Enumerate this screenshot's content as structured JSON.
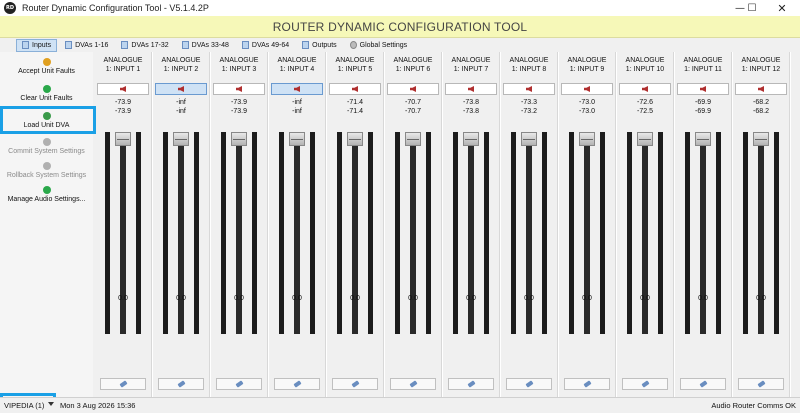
{
  "window": {
    "title": "Router Dynamic Configuration Tool - V5.1.4.2P",
    "app_icon": "RD",
    "controls": {
      "minimize": "—",
      "maximize": "☐",
      "close": "✕"
    }
  },
  "banner": {
    "title": "ROUTER DYNAMIC CONFIGURATION TOOL"
  },
  "tabs": [
    {
      "label": "Inputs",
      "active": true,
      "icon": "dva-page-icon"
    },
    {
      "label": "DVAs 1-16",
      "icon": "dva-page-icon"
    },
    {
      "label": "DVAs 17-32",
      "icon": "dva-page-icon"
    },
    {
      "label": "DVAs 33-48",
      "icon": "dva-page-icon"
    },
    {
      "label": "DVAs 49-64",
      "icon": "dva-page-icon"
    },
    {
      "label": "Outputs",
      "icon": "dva-page-icon"
    },
    {
      "label": "Global Settings",
      "icon": "gear-icon"
    }
  ],
  "sidebar": {
    "items": [
      {
        "label": "Accept Unit Faults",
        "icon": "accept-faults-icon",
        "enabled": true
      },
      {
        "label": "Clear Unit Faults",
        "icon": "check-icon",
        "enabled": true
      },
      {
        "label": "Load Unit DVA",
        "icon": "speaker-arrow-icon",
        "enabled": true
      },
      {
        "label": "Commit System Settings",
        "icon": "commit-icon",
        "enabled": false
      },
      {
        "label": "Rollback System Settings",
        "icon": "rollback-icon",
        "enabled": false
      },
      {
        "label": "Manage Audio Settings...",
        "icon": "refresh-icon",
        "enabled": true
      }
    ],
    "highlight_color": "#1aa0e6"
  },
  "channels": [
    {
      "line1": "ANALOGUE",
      "line2": "1: INPUT 1",
      "level_a": "-73.9",
      "level_b": "-73.9",
      "fader": "0.0",
      "selected": false
    },
    {
      "line1": "ANALOGUE",
      "line2": "1: INPUT 2",
      "level_a": "-inf",
      "level_b": "-inf",
      "fader": "0.0",
      "selected": true
    },
    {
      "line1": "ANALOGUE",
      "line2": "1: INPUT 3",
      "level_a": "-73.9",
      "level_b": "-73.9",
      "fader": "0.0",
      "selected": false
    },
    {
      "line1": "ANALOGUE",
      "line2": "1: INPUT 4",
      "level_a": "-inf",
      "level_b": "-inf",
      "fader": "0.0",
      "selected": true
    },
    {
      "line1": "ANALOGUE",
      "line2": "1: INPUT 5",
      "level_a": "-71.4",
      "level_b": "-71.4",
      "fader": "0.0",
      "selected": false
    },
    {
      "line1": "ANALOGUE",
      "line2": "1: INPUT 6",
      "level_a": "-70.7",
      "level_b": "-70.7",
      "fader": "0.0",
      "selected": false
    },
    {
      "line1": "ANALOGUE",
      "line2": "1: INPUT 7",
      "level_a": "-73.8",
      "level_b": "-73.8",
      "fader": "0.0",
      "selected": false
    },
    {
      "line1": "ANALOGUE",
      "line2": "1: INPUT 8",
      "level_a": "-73.3",
      "level_b": "-73.2",
      "fader": "0.0",
      "selected": false
    },
    {
      "line1": "ANALOGUE",
      "line2": "1: INPUT 9",
      "level_a": "-73.0",
      "level_b": "-73.0",
      "fader": "0.0",
      "selected": false
    },
    {
      "line1": "ANALOGUE",
      "line2": "1: INPUT 10",
      "level_a": "-72.6",
      "level_b": "-72.5",
      "fader": "0.0",
      "selected": false
    },
    {
      "line1": "ANALOGUE",
      "line2": "1: INPUT 11",
      "level_a": "-69.9",
      "level_b": "-69.9",
      "fader": "0.0",
      "selected": false
    },
    {
      "line1": "ANALOGUE",
      "line2": "1: INPUT 12",
      "level_a": "-68.2",
      "level_b": "-68.2",
      "fader": "0.0",
      "selected": false
    }
  ],
  "colors": {
    "banner_bg": "#f6f8b8",
    "selected_bg": "#cfe2f5",
    "meter_bg": "#1c1c1c",
    "highlight_box": "#1aa0e6"
  },
  "statusbar": {
    "unit": "VIPEDIA (1)",
    "datetime": "Mon 3 Aug 2026 15:36",
    "comms": "Audio Router Comms OK"
  }
}
